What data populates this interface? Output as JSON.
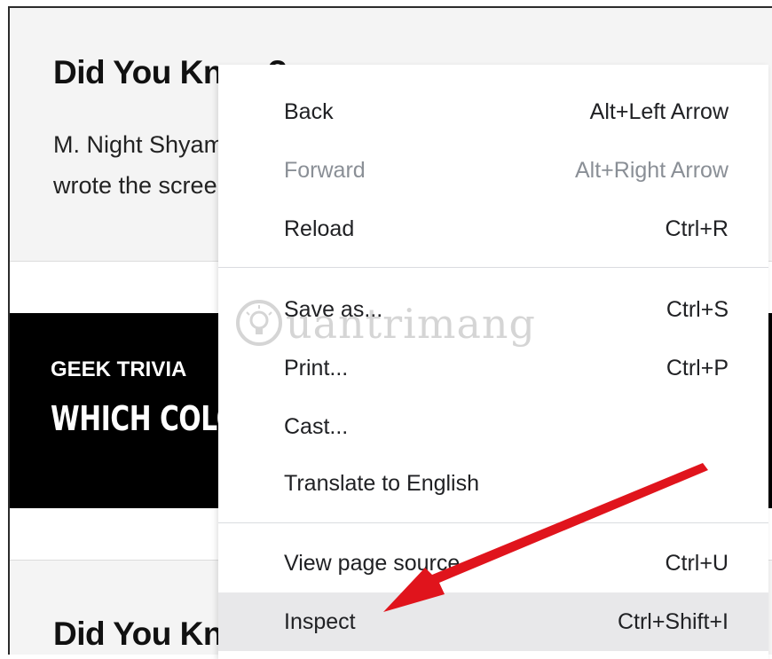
{
  "page": {
    "top_card": {
      "title": "Did You Know?",
      "text_line_1": "M. Night Shyamalan",
      "text_line_2": "wrote the screenplay"
    },
    "trivia": {
      "kicker": "GEEK TRIVIA",
      "question": "WHICH COLOR"
    },
    "bottom_card": {
      "title": "Did You Know?"
    }
  },
  "context_menu": {
    "items": [
      {
        "label": "Back",
        "shortcut": "Alt+Left Arrow",
        "disabled": false
      },
      {
        "label": "Forward",
        "shortcut": "Alt+Right Arrow",
        "disabled": true
      },
      {
        "label": "Reload",
        "shortcut": "Ctrl+R",
        "disabled": false
      },
      {
        "label": "Save as...",
        "shortcut": "Ctrl+S",
        "disabled": false
      },
      {
        "label": "Print...",
        "shortcut": "Ctrl+P",
        "disabled": false
      },
      {
        "label": "Cast...",
        "shortcut": "",
        "disabled": false
      },
      {
        "label": "Translate to English",
        "shortcut": "",
        "disabled": false
      },
      {
        "label": "View page source",
        "shortcut": "Ctrl+U",
        "disabled": false
      },
      {
        "label": "Inspect",
        "shortcut": "Ctrl+Shift+I",
        "disabled": false,
        "highlighted": true
      }
    ]
  },
  "watermark": {
    "text": "uantrimang",
    "icon": "lightbulb-icon"
  },
  "annotation": {
    "arrow_color": "#e0141c",
    "arrow_icon": "red-arrow-icon"
  }
}
